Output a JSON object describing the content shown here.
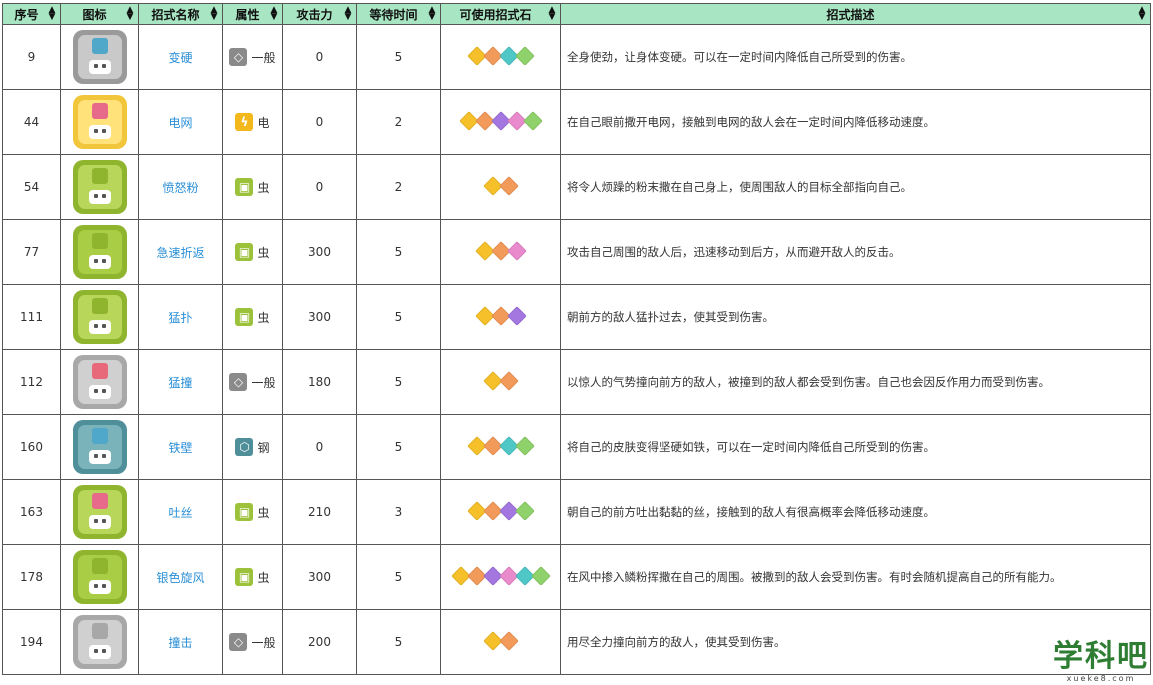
{
  "table": {
    "headers": [
      "序号",
      "图标",
      "招式名称",
      "属性",
      "攻击力",
      "等待时间",
      "可使用招式石",
      "招式描述"
    ],
    "rows": [
      {
        "id": "9",
        "icon": "guard-shield-icon",
        "name": "变硬",
        "type": "一般",
        "attack": "0",
        "wait": "5",
        "stones": [
          "#f5c02a",
          "#f29a5a",
          "#4fc7c7",
          "#8fd16a"
        ],
        "desc": "全身使劲，让身体变硬。可以在一定时间内降低自己所受到的伤害。"
      },
      {
        "id": "44",
        "icon": "electric-web-icon",
        "name": "电网",
        "type": "电",
        "attack": "0",
        "wait": "2",
        "stones": [
          "#f5c02a",
          "#f29a5a",
          "#a476e0",
          "#e88acb",
          "#8fd16a"
        ],
        "desc": "在自己眼前撒开电网，接触到电网的敌人会在一定时间内降低移动速度。"
      },
      {
        "id": "54",
        "icon": "angry-powder-icon",
        "name": "愤怒粉",
        "type": "虫",
        "attack": "0",
        "wait": "2",
        "stones": [
          "#f5c02a",
          "#f29a5a"
        ],
        "desc": "将令人烦躁的粉末撒在自己身上，使周围敌人的目标全部指向自己。"
      },
      {
        "id": "77",
        "icon": "quick-return-icon",
        "name": "急速折返",
        "type": "虫",
        "attack": "300",
        "wait": "5",
        "stones": [
          "#f5c02a",
          "#f29a5a",
          "#e88acb"
        ],
        "desc": "攻击自己周围的敌人后，迅速移动到后方，从而避开敌人的反击。"
      },
      {
        "id": "111",
        "icon": "pounce-icon",
        "name": "猛扑",
        "type": "虫",
        "attack": "300",
        "wait": "5",
        "stones": [
          "#f5c02a",
          "#f29a5a",
          "#a476e0"
        ],
        "desc": "朝前方的敌人猛扑过去，使其受到伤害。"
      },
      {
        "id": "112",
        "icon": "double-edge-icon",
        "name": "猛撞",
        "type": "一般",
        "attack": "180",
        "wait": "5",
        "stones": [
          "#f5c02a",
          "#f29a5a"
        ],
        "desc": "以惊人的气势撞向前方的敌人，被撞到的敌人都会受到伤害。自己也会因反作用力而受到伤害。"
      },
      {
        "id": "160",
        "icon": "iron-defense-icon",
        "name": "铁壁",
        "type": "钢",
        "attack": "0",
        "wait": "5",
        "stones": [
          "#f5c02a",
          "#f29a5a",
          "#4fc7c7",
          "#8fd16a"
        ],
        "desc": "将自己的皮肤变得坚硬如铁，可以在一定时间内降低自己所受到的伤害。"
      },
      {
        "id": "163",
        "icon": "string-shot-icon",
        "name": "吐丝",
        "type": "虫",
        "attack": "210",
        "wait": "3",
        "stones": [
          "#f5c02a",
          "#f29a5a",
          "#a476e0",
          "#8fd16a"
        ],
        "desc": "朝自己的前方吐出黏黏的丝，接触到的敌人有很高概率会降低移动速度。"
      },
      {
        "id": "178",
        "icon": "silver-wind-icon",
        "name": "银色旋风",
        "type": "虫",
        "attack": "300",
        "wait": "5",
        "stones": [
          "#f5c02a",
          "#f29a5a",
          "#a476e0",
          "#e88acb",
          "#4fc7c7",
          "#8fd16a"
        ],
        "desc": "在风中掺入鳞粉挥撒在自己的周围。被撒到的敌人会受到伤害。有时会随机提高自己的所有能力。"
      },
      {
        "id": "194",
        "icon": "tackle-icon",
        "name": "撞击",
        "type": "一般",
        "attack": "200",
        "wait": "5",
        "stones": [
          "#f5c02a",
          "#f29a5a"
        ],
        "desc": "用尽全力撞向前方的敌人，使其受到伤害。"
      }
    ]
  },
  "type_styles": {
    "一般": {
      "color": "#8a8a8a",
      "glyph": "◇"
    },
    "电": {
      "color": "#f2b81c",
      "glyph": "ϟ"
    },
    "虫": {
      "color": "#9cc13a",
      "glyph": "▣"
    },
    "钢": {
      "color": "#4f8f9a",
      "glyph": "⬡"
    }
  },
  "icon_styles": {
    "guard-shield-icon": {
      "outer": "#9a9a9a",
      "inner": "#c9c9c9",
      "badge": "#4fa7c9"
    },
    "electric-web-icon": {
      "outer": "#f2c63a",
      "inner": "#ffe27a",
      "badge": "#e86a8a"
    },
    "angry-powder-icon": {
      "outer": "#8fb52e",
      "inner": "#b7d65a",
      "badge": "#8fb52e"
    },
    "quick-return-icon": {
      "outer": "#8fb52e",
      "inner": "#a9cd45",
      "badge": "#8fb52e"
    },
    "pounce-icon": {
      "outer": "#8fb52e",
      "inner": "#b7d65a",
      "badge": "#8fb52e"
    },
    "double-edge-icon": {
      "outer": "#a8a8a8",
      "inner": "#d0d0d0",
      "badge": "#e86a7a"
    },
    "iron-defense-icon": {
      "outer": "#4f8f9a",
      "inner": "#7bb3bb",
      "badge": "#4fa7c9"
    },
    "string-shot-icon": {
      "outer": "#8fb52e",
      "inner": "#b7d65a",
      "badge": "#e86a8a"
    },
    "silver-wind-icon": {
      "outer": "#8fb52e",
      "inner": "#a9cd45",
      "badge": "#8fb52e"
    },
    "tackle-icon": {
      "outer": "#a8a8a8",
      "inner": "#d0d0d0",
      "badge": "#a8a8a8"
    }
  },
  "watermark": {
    "big": "学科吧",
    "small": "xueke8.com"
  }
}
